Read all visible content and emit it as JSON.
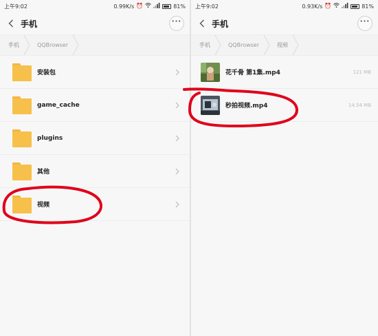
{
  "left": {
    "status": {
      "time": "上午9:02",
      "speed": "0.99K/s",
      "battery": "81%"
    },
    "title": "手机",
    "breadcrumb": [
      "手机",
      "QQBrowser"
    ],
    "folders": [
      "安装包",
      "game_cache",
      "plugins",
      "其他",
      "视频"
    ]
  },
  "right": {
    "status": {
      "time": "上午9:02",
      "speed": "0.93K/s",
      "battery": "81%"
    },
    "title": "手机",
    "breadcrumb": [
      "手机",
      "QQBrowser",
      "视频"
    ],
    "files": [
      {
        "name": "花千骨 第1集.mp4",
        "size": "121 MB"
      },
      {
        "name": "秒拍视频.mp4",
        "size": "14.54 MB"
      }
    ]
  },
  "colors": {
    "folder": "#f7c04b",
    "annotation": "#e0001b"
  }
}
